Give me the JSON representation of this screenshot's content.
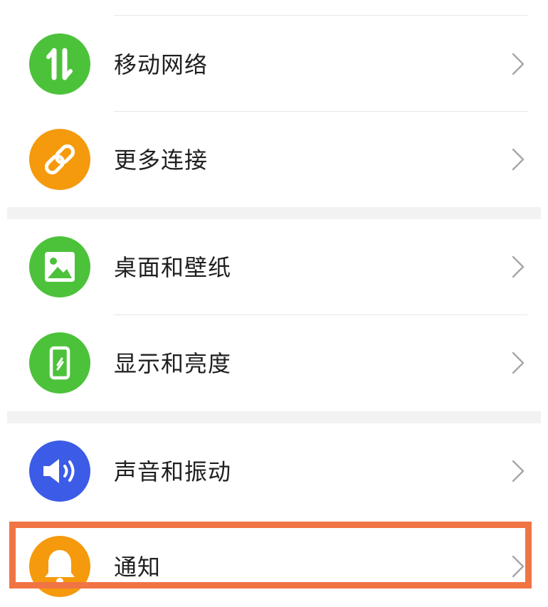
{
  "settings": {
    "items": [
      {
        "label": "移动网络",
        "icon": "mobile-data-icon",
        "color": "#4cc23a"
      },
      {
        "label": "更多连接",
        "icon": "link-icon",
        "color": "#f59a0c"
      },
      {
        "label": "桌面和壁纸",
        "icon": "image-icon",
        "color": "#4cc23a"
      },
      {
        "label": "显示和亮度",
        "icon": "phone-brightness-icon",
        "color": "#4cc23a"
      },
      {
        "label": "声音和振动",
        "icon": "speaker-icon",
        "color": "#3c5be6"
      },
      {
        "label": "通知",
        "icon": "bell-icon",
        "color": "#f59a0c"
      }
    ]
  },
  "colors": {
    "highlight_border": "#f07444",
    "section_gap": "#f2f2f2",
    "divider": "#e6e6e6",
    "chevron": "#a6a6a6"
  }
}
